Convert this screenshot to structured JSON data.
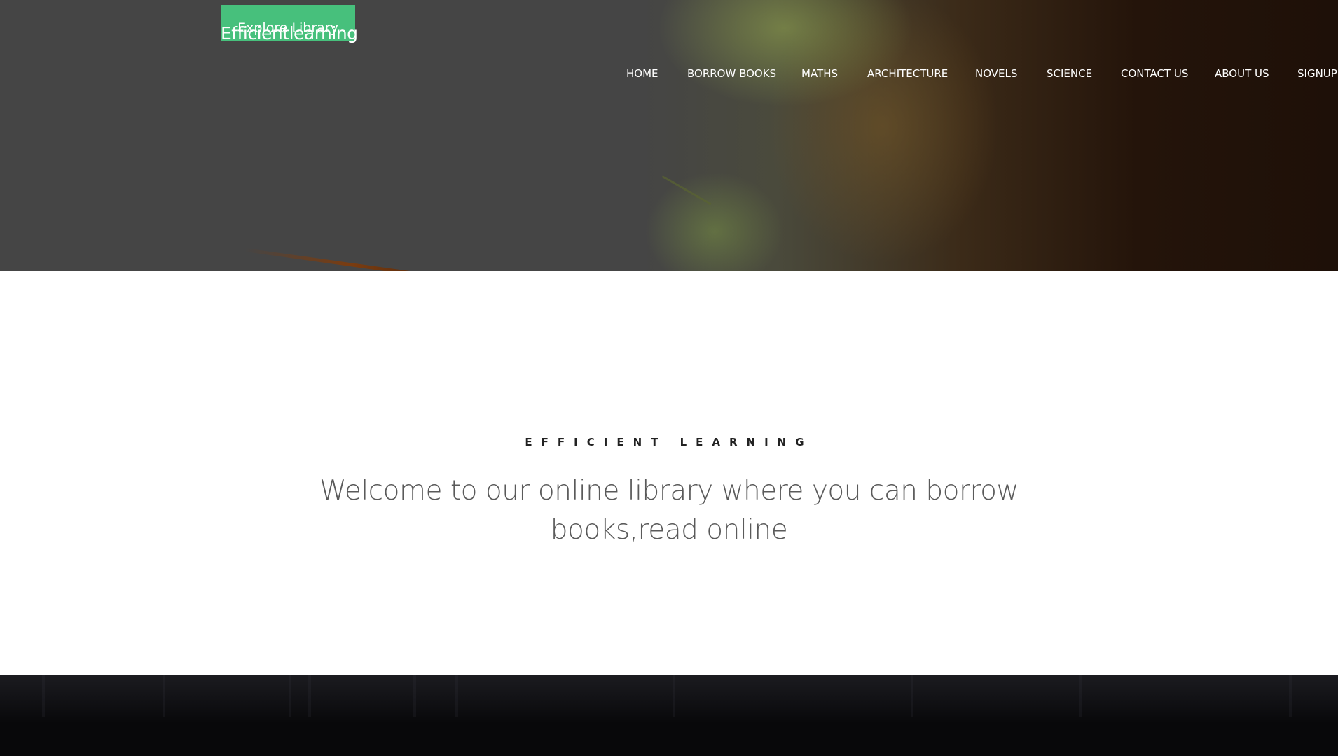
{
  "hero": {
    "explore_button": "Explore Library",
    "brand": "Efficientlearning",
    "nav": [
      "HOME",
      "BORROW BOOKS",
      "MATHS",
      "ARCHITECTURE",
      "NOVELS",
      "SCIENCE",
      "CONTACT US",
      "ABOUT US",
      "SIGNUP"
    ]
  },
  "intro": {
    "eyebrow": "EFFICIENT LEARNING",
    "headline_line1": "Welcome to our online library where you can borrow",
    "headline_line2": "books,read online"
  },
  "colors": {
    "accent": "#47c07c",
    "hero_overlay": "#454545",
    "footer_band": "#050507"
  }
}
